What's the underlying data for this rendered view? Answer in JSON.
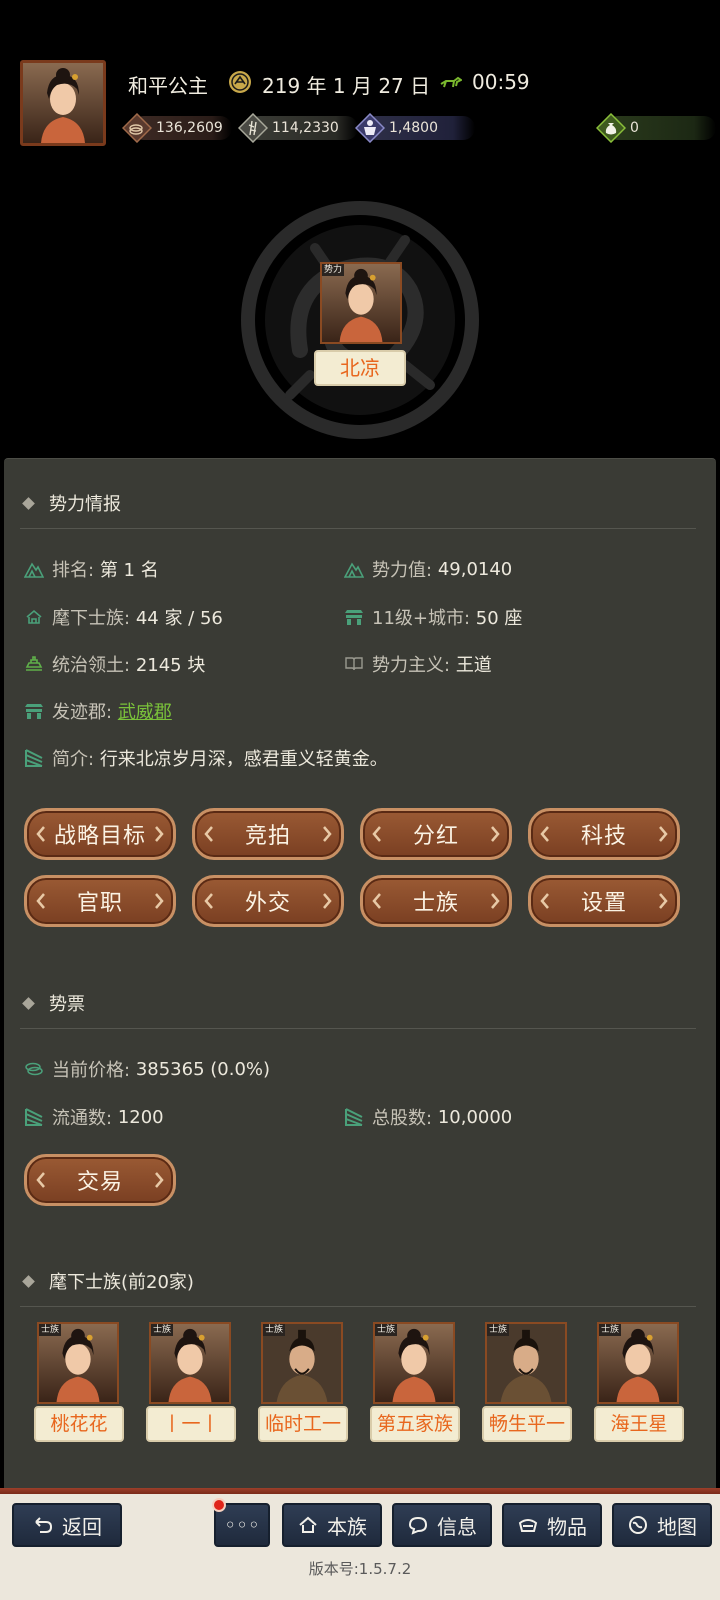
{
  "player": {
    "name": "和平公主"
  },
  "datetime": {
    "date": "219 年 1 月 27 日",
    "time": "00:59"
  },
  "resources": {
    "gold": {
      "icon": "coins-icon",
      "value": "136,2609"
    },
    "food": {
      "icon": "grain-icon",
      "value": "114,2330"
    },
    "troops": {
      "icon": "soldier-icon",
      "value": "1,4800"
    },
    "token": {
      "icon": "money-bag-icon",
      "value": "0"
    }
  },
  "faction": {
    "tag": "势力",
    "name": "北凉"
  },
  "intel": {
    "title": "势力情报",
    "rank_label": "排名:",
    "rank_value": "第 1 名",
    "power_label": "势力值:",
    "power_value": "49,0140",
    "clans_label": "麾下士族:",
    "clans_value": "44 家 / 56",
    "cities_label": "11级+城市:",
    "cities_value": "50 座",
    "territory_label": "统治领土:",
    "territory_value": "2145 块",
    "doctrine_label": "势力主义:",
    "doctrine_value": "王道",
    "origin_label": "发迹郡:",
    "origin_value": "武威郡",
    "intro_label": "简介:",
    "intro_value": "行来北凉岁月深，感君重义轻黄金。"
  },
  "actions": [
    {
      "label": "战略目标"
    },
    {
      "label": "竞拍"
    },
    {
      "label": "分红"
    },
    {
      "label": "科技"
    },
    {
      "label": "官职"
    },
    {
      "label": "外交"
    },
    {
      "label": "士族"
    },
    {
      "label": "设置"
    }
  ],
  "stock": {
    "title": "势票",
    "price_label": "当前价格:",
    "price_value": "385365 (0.0%)",
    "float_label": "流通数:",
    "float_value": "1200",
    "total_label": "总股数:",
    "total_value": "10,0000",
    "trade_label": "交易"
  },
  "clans": {
    "title": "麾下士族(前20家)",
    "tag": "士族",
    "items": [
      {
        "name": "桃花花"
      },
      {
        "name": "丨一丨"
      },
      {
        "name": "临时工一"
      },
      {
        "name": "第五家族"
      },
      {
        "name": "畅生平一"
      },
      {
        "name": "海王星"
      }
    ]
  },
  "nav": {
    "back": "返回",
    "more": "◦◦◦",
    "clan": "本族",
    "info": "信息",
    "items": "物品",
    "map": "地图"
  },
  "version": "版本号:1.5.7.2",
  "colors": {
    "accent_orange": "#e8671e",
    "link_green": "#7ac23a",
    "button_brown": "#8a4a28",
    "panel": "#3a3b35"
  }
}
